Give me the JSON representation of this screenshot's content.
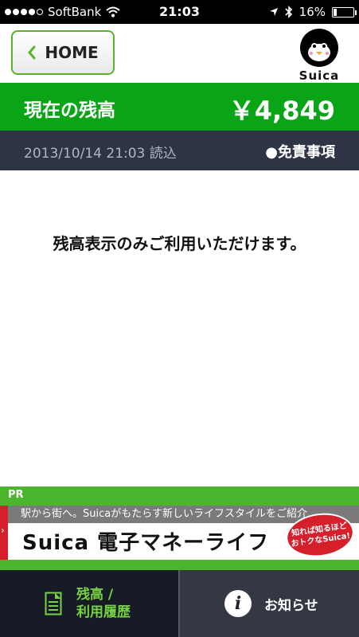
{
  "status_bar": {
    "carrier": "SoftBank",
    "time": "21:03",
    "battery": "16%",
    "battery_level": 0.16
  },
  "header": {
    "home_label": "HOME",
    "logo_text": "Suica"
  },
  "balance": {
    "label": "現在の残高",
    "amount": "￥4,849"
  },
  "info": {
    "read_datetime": "2013/10/14 21:03 読込",
    "disclaimer": "●免責事項"
  },
  "message": "残高表示のみご利用いただけます。",
  "pr": {
    "label": "PR",
    "banner_top": "駅から街へ。Suicaがもたらす新しいライフスタイルをご紹介",
    "banner_main": "Suica 電子マネーライフ",
    "badge_line1": "知れば知るほど",
    "badge_line2": "おトクなSuica!"
  },
  "tabs": {
    "balance_line1": "残高 /",
    "balance_line2": "利用履歴",
    "news": "お知らせ"
  },
  "colors": {
    "green": "#0aa516",
    "dark_navy": "#2c3446",
    "accent_green": "#76d145"
  }
}
